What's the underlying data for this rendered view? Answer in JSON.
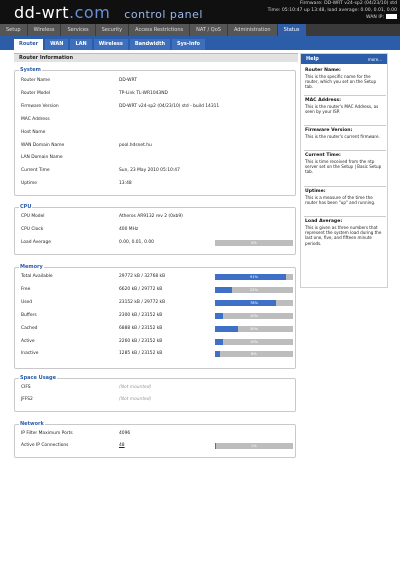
{
  "header": {
    "logo_main": "dd-wrt",
    "logo_dot": ".com",
    "logo_sub": "control panel",
    "firmware_line": "Firmware: DD-WRT v24-sp2 (04/23/10) std",
    "time_line": "Time: 05:10:47 up 13:48, load average: 0.00, 0.01, 0.00",
    "wan_ip_label": "WAN IP:"
  },
  "main_tabs": [
    "Setup",
    "Wireless",
    "Services",
    "Security",
    "Access Restrictions",
    "NAT / QoS",
    "Administration",
    "Status"
  ],
  "main_tab_active": "Status",
  "sub_tabs": [
    "Router",
    "WAN",
    "LAN",
    "Wireless",
    "Bandwidth",
    "Sys-Info"
  ],
  "sub_tab_active": "Router",
  "page_title": "Router Information",
  "system": {
    "legend": "System",
    "rows": [
      {
        "label": "Router Name",
        "value": "DD-WRT"
      },
      {
        "label": "Router Model",
        "value": "TP-Link TL-WR1043ND"
      },
      {
        "label": "Firmware Version",
        "value": "DD-WRT v24-sp2 (04/23/10) std - build 14311"
      },
      {
        "label": "MAC Address",
        "value": ""
      },
      {
        "label": "Host Name",
        "value": ""
      },
      {
        "label": "WAN Domain Name",
        "value": "pool.hdsnet.hu"
      },
      {
        "label": "LAN Domain Name",
        "value": ""
      },
      {
        "label": "Current Time",
        "value": "Sun, 23 May 2010 05:10:47"
      },
      {
        "label": "Uptime",
        "value": "13:48"
      }
    ]
  },
  "cpu": {
    "legend": "CPU",
    "rows": [
      {
        "label": "CPU Model",
        "value": "Atheros AR9132 rev 2 (0xb9)"
      },
      {
        "label": "CPU Clock",
        "value": "400 MHz"
      },
      {
        "label": "Load Average",
        "value": "0.00, 0.01, 0.00",
        "percent": 0,
        "percent_label": "0%"
      }
    ]
  },
  "memory": {
    "legend": "Memory",
    "rows": [
      {
        "label": "Total Available",
        "value": "29772 kB / 32768 kB",
        "percent": 91,
        "percent_label": "91%"
      },
      {
        "label": "Free",
        "value": "6620 kB / 29772 kB",
        "percent": 22,
        "percent_label": "22%"
      },
      {
        "label": "Used",
        "value": "23152 kB / 29772 kB",
        "percent": 78,
        "percent_label": "78%"
      },
      {
        "label": "Buffers",
        "value": "2300 kB / 23152 kB",
        "percent": 10,
        "percent_label": "10%"
      },
      {
        "label": "Cached",
        "value": "6888 kB / 23152 kB",
        "percent": 30,
        "percent_label": "30%"
      },
      {
        "label": "Active",
        "value": "2260 kB / 23152 kB",
        "percent": 10,
        "percent_label": "10%"
      },
      {
        "label": "Inactive",
        "value": "1285 kB / 23152 kB",
        "percent": 6,
        "percent_label": "6%"
      }
    ]
  },
  "space": {
    "legend": "Space Usage",
    "rows": [
      {
        "label": "CIFS",
        "value": "(Not mounted)"
      },
      {
        "label": "JFFS2",
        "value": "(Not mounted)"
      }
    ]
  },
  "network": {
    "legend": "Network",
    "rows": [
      {
        "label": "IP Filter Maximum Ports",
        "value": "4096"
      },
      {
        "label": "Active IP Connections",
        "value": "48",
        "percent": 1,
        "percent_label": "1%"
      }
    ]
  },
  "help": {
    "title": "Help",
    "more": "more...",
    "items": [
      {
        "heading": "Router Name:",
        "text": "This is the specific name for the router, which you set on the Setup tab."
      },
      {
        "heading": "MAC Address:",
        "text": "This is the router's MAC Address, as seen by your ISP."
      },
      {
        "heading": "Firmware Version:",
        "text": "This is the router's current firmware."
      },
      {
        "heading": "Current Time:",
        "text": "This is time received from the ntp server set on the Setup | Basic Setup tab."
      },
      {
        "heading": "Uptime:",
        "text": "This is a measure of the time the router has been \"up\" and running."
      },
      {
        "heading": "Load Average:",
        "text": "This is given as three numbers that represent the system load during the last one, five, and fifteen minute periods."
      }
    ]
  },
  "colors": {
    "accent": "#2b5da8",
    "bar_fill": "#3f70c7",
    "bar_bg": "#bdbdbd",
    "header_bg": "#101010"
  }
}
